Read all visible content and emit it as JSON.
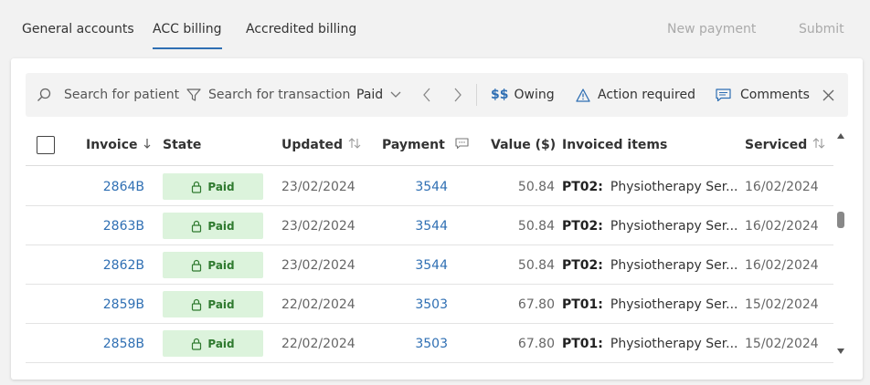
{
  "tabs": [
    {
      "label": "General accounts",
      "active": false
    },
    {
      "label": "ACC billing",
      "active": true
    },
    {
      "label": "Accredited billing",
      "active": false
    }
  ],
  "actions": {
    "new_payment": "New payment",
    "submit": "Submit"
  },
  "toolbar": {
    "search_patient_placeholder": "Search for patient",
    "search_transaction_placeholder": "Search for transaction",
    "state_filter": "Paid",
    "owing_icon": "$$",
    "owing": "Owing",
    "action_required": "Action required",
    "comments": "Comments"
  },
  "table": {
    "columns": {
      "invoice": "Invoice",
      "state": "State",
      "updated": "Updated",
      "payment": "Payment",
      "value": "Value ($)",
      "invoiced_items": "Invoiced items",
      "serviced": "Serviced"
    },
    "rows": [
      {
        "invoice": "2864B",
        "state": "Paid",
        "updated": "23/02/2024",
        "payment": "3544",
        "value": "50.84",
        "code": "PT02:",
        "item": "Physiotherapy Ser...",
        "serviced": "16/02/2024"
      },
      {
        "invoice": "2863B",
        "state": "Paid",
        "updated": "23/02/2024",
        "payment": "3544",
        "value": "50.84",
        "code": "PT02:",
        "item": "Physiotherapy Ser...",
        "serviced": "16/02/2024"
      },
      {
        "invoice": "2862B",
        "state": "Paid",
        "updated": "23/02/2024",
        "payment": "3544",
        "value": "50.84",
        "code": "PT02:",
        "item": "Physiotherapy Ser...",
        "serviced": "16/02/2024"
      },
      {
        "invoice": "2859B",
        "state": "Paid",
        "updated": "22/02/2024",
        "payment": "3503",
        "value": "67.80",
        "code": "PT01:",
        "item": "Physiotherapy Ser...",
        "serviced": "15/02/2024"
      },
      {
        "invoice": "2858B",
        "state": "Paid",
        "updated": "22/02/2024",
        "payment": "3503",
        "value": "67.80",
        "code": "PT01:",
        "item": "Physiotherapy Ser...",
        "serviced": "15/02/2024"
      }
    ]
  },
  "colors": {
    "accent": "#2f6fb3",
    "paid_bg": "#dcf3dc",
    "paid_text": "#2f7a2f"
  }
}
